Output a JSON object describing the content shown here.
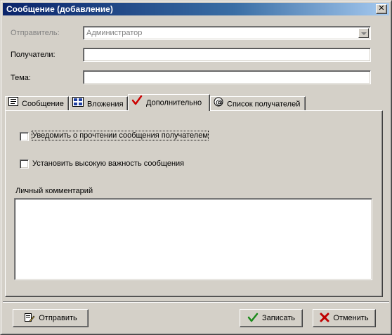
{
  "window": {
    "title": "Сообщение (добавление)",
    "close_glyph": "✕"
  },
  "form": {
    "sender_label": "Отправитель:",
    "sender_value": "Администратор",
    "recipients_label": "Получатели:",
    "recipients_value": "",
    "subject_label": "Тема:",
    "subject_value": ""
  },
  "tabs": [
    {
      "label": "Сообщение",
      "icon": "message-icon"
    },
    {
      "label": "Вложения",
      "icon": "attachments-icon"
    },
    {
      "label": "Дополнительно",
      "icon": "checkmark-icon",
      "active": true
    },
    {
      "label": "Список получателей",
      "icon": "recipients-list-icon"
    }
  ],
  "extra": {
    "read_receipt_label": "Уведомить о прочтении сообщения получателем",
    "read_receipt_checked": false,
    "high_importance_label": "Установить высокую важность сообщения",
    "high_importance_checked": false,
    "comment_label": "Личный комментарий",
    "comment_value": ""
  },
  "buttons": {
    "send": "Отправить",
    "save": "Записать",
    "cancel": "Отменить"
  },
  "colors": {
    "title_start": "#0a246a",
    "title_end": "#a6caf0",
    "check_red": "#cc0000",
    "check_green": "#1a8a1a",
    "cancel_red": "#c00000"
  }
}
